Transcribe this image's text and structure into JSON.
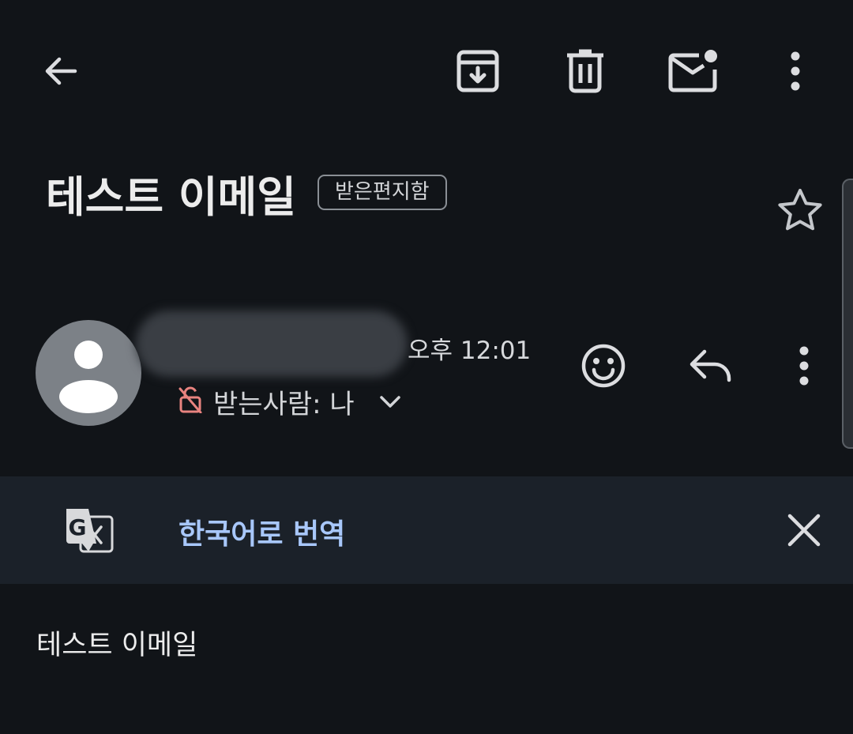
{
  "toolbar": {
    "back_icon": "arrow-back-icon",
    "archive_icon": "archive-icon",
    "delete_icon": "trash-icon",
    "mark_unread_icon": "mark-unread-icon",
    "more_icon": "more-vert-icon"
  },
  "email": {
    "subject": "테스트 이메일",
    "label": "받은편지함",
    "starred": false,
    "time": "오후 12:01",
    "recipient": "받는사람: 나",
    "body": "테스트 이메일"
  },
  "translate": {
    "label": "한국어로 번역"
  },
  "colors": {
    "background": "#111418",
    "banner": "#1b2129",
    "link": "#a8c7fa",
    "lock_icon": "#e8837f",
    "avatar": "#7c8187"
  }
}
